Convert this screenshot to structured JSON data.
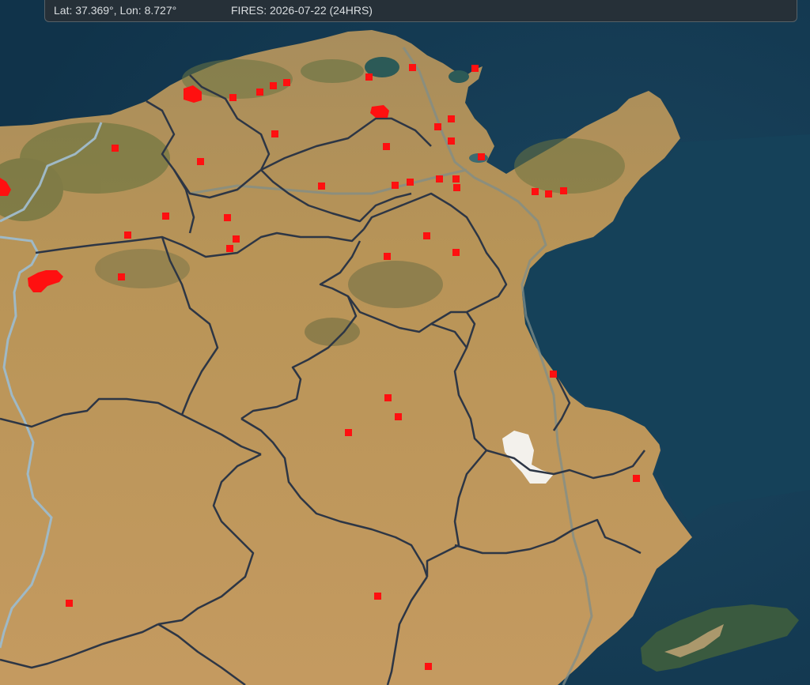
{
  "status_bar": {
    "coordinates": "Lat: 37.369°, Lon: 8.727°",
    "fires_label": "FIRES: 2026-07-22 (24HRS)"
  },
  "map": {
    "colors": {
      "sea": "#14384f",
      "land": "#bd955c",
      "province_border": "#2d3645",
      "national_border": "#9fb9c6",
      "fire": "#ff1010",
      "lake": "#2c5a57",
      "salt_flat": "#f3f1ec"
    },
    "layers": [
      "satellite-basemap",
      "admin-boundaries",
      "national-border",
      "roads",
      "active-fires"
    ],
    "fire_detections": [
      {
        "shape": "cluster"
      },
      {
        "shape": "cluster"
      },
      {
        "shape": "cluster"
      },
      {
        "shape": "cluster"
      },
      {
        "shape": "square"
      },
      {
        "shape": "square"
      },
      {
        "shape": "square"
      },
      {
        "shape": "square"
      },
      {
        "shape": "square"
      },
      {
        "shape": "square"
      },
      {
        "shape": "square"
      },
      {
        "shape": "square"
      },
      {
        "shape": "square"
      },
      {
        "shape": "square"
      },
      {
        "shape": "square"
      },
      {
        "shape": "square"
      },
      {
        "shape": "square"
      },
      {
        "shape": "square"
      },
      {
        "shape": "square"
      },
      {
        "shape": "square"
      },
      {
        "shape": "square"
      },
      {
        "shape": "square"
      },
      {
        "shape": "square"
      },
      {
        "shape": "square"
      },
      {
        "shape": "square"
      },
      {
        "shape": "square"
      },
      {
        "shape": "square"
      },
      {
        "shape": "square"
      },
      {
        "shape": "square"
      },
      {
        "shape": "square"
      },
      {
        "shape": "square"
      },
      {
        "shape": "square"
      },
      {
        "shape": "square"
      },
      {
        "shape": "square"
      },
      {
        "shape": "square"
      },
      {
        "shape": "square"
      },
      {
        "shape": "square"
      },
      {
        "shape": "square"
      },
      {
        "shape": "square"
      },
      {
        "shape": "square"
      },
      {
        "shape": "square"
      },
      {
        "shape": "square"
      },
      {
        "shape": "square"
      },
      {
        "shape": "square"
      },
      {
        "shape": "square"
      },
      {
        "shape": "square"
      },
      {
        "shape": "square"
      }
    ]
  }
}
